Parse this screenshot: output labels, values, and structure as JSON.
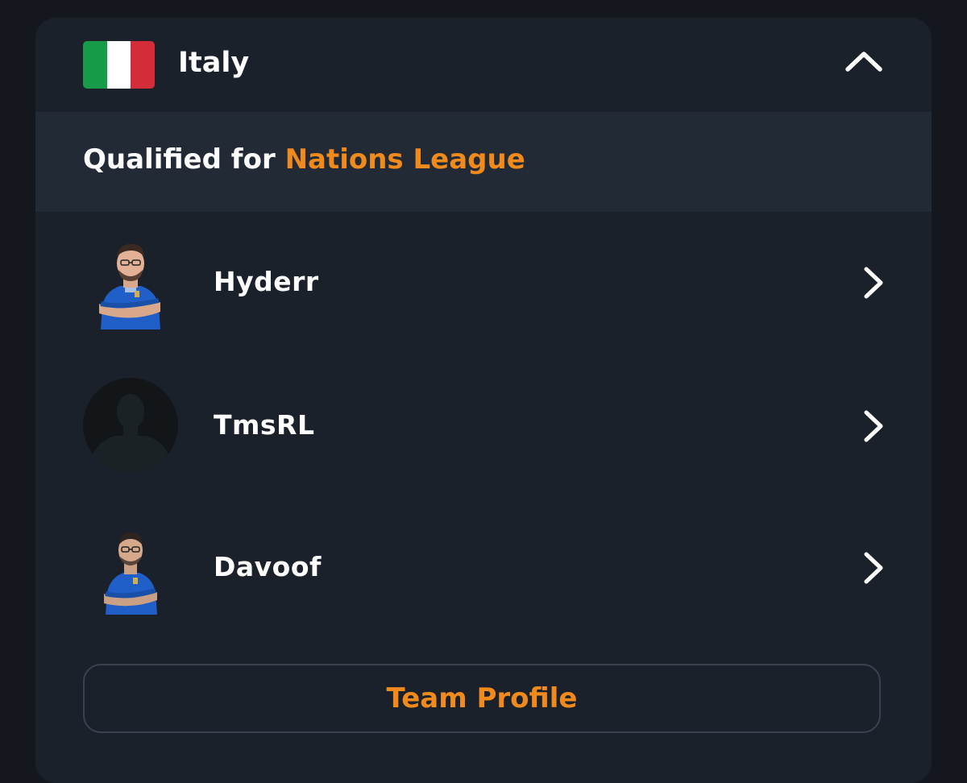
{
  "team": {
    "country": "Italy",
    "flag_icon": "italy-flag-icon",
    "flag_colors": [
      "#169b48",
      "#ffffff",
      "#d32d3a"
    ],
    "expanded": true
  },
  "qualification": {
    "prefix": "Qualified for",
    "event": "Nations League"
  },
  "players": [
    {
      "name": "Hyderr",
      "avatar": "player-photo"
    },
    {
      "name": "TmsRL",
      "avatar": "silhouette-placeholder"
    },
    {
      "name": "Davoof",
      "avatar": "player-photo"
    }
  ],
  "actions": {
    "team_profile_label": "Team Profile"
  },
  "colors": {
    "accent": "#f08a1c",
    "card_bg": "#1b212a",
    "band_bg": "#222a36",
    "page_bg": "#14181e",
    "text": "#ffffff"
  }
}
